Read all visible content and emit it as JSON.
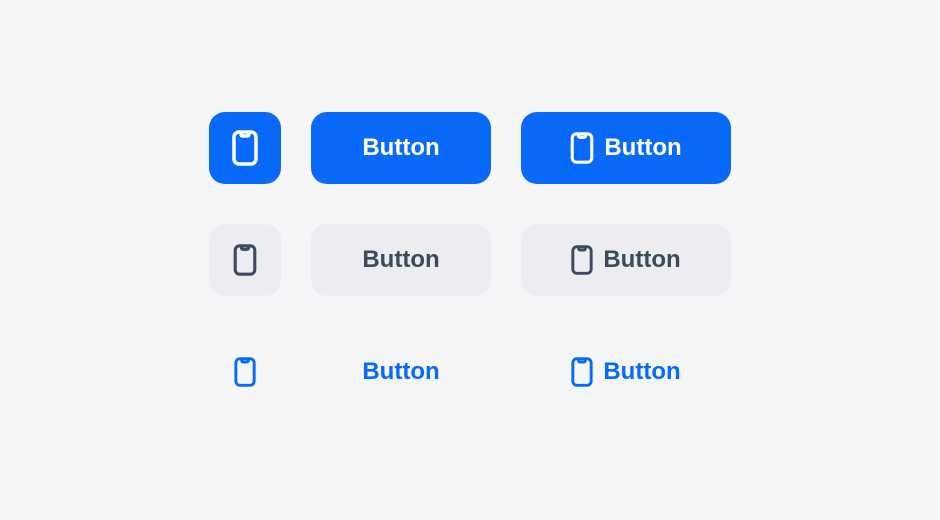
{
  "buttons": {
    "primary": {
      "icon_only": "",
      "text_only": "Button",
      "icon_text": "Button"
    },
    "secondary": {
      "icon_only": "",
      "text_only": "Button",
      "icon_text": "Button"
    },
    "text": {
      "icon_only": "",
      "text_only": "Button",
      "icon_text": "Button"
    }
  },
  "colors": {
    "primary": "#0969f8",
    "secondary_bg": "#ebedf0",
    "secondary_text": "#3d4a5c",
    "page_bg": "#f4f6f8"
  },
  "icon_name": "phone-icon"
}
